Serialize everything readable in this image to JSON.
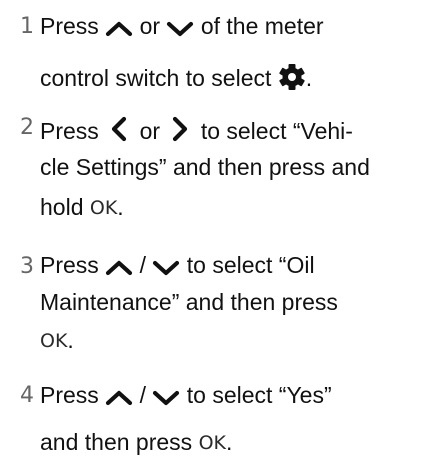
{
  "steps": [
    {
      "number": "1",
      "lines": [
        {
          "t1": "Press",
          "t2": "or",
          "t3": "of the meter"
        },
        {
          "t1": "control switch to select",
          "t2": "."
        }
      ]
    },
    {
      "number": "2",
      "lines": [
        {
          "t1": "Press",
          "t2": "or",
          "t3": "to select “Vehi-"
        },
        {
          "t1": "cle Settings” and then press and"
        },
        {
          "t1": "hold",
          "t2": "."
        }
      ]
    },
    {
      "number": "3",
      "lines": [
        {
          "t1": "Press",
          "t2": "/",
          "t3": "to select “Oil"
        },
        {
          "t1": "Maintenance” and then press"
        },
        {
          "t2": "."
        }
      ]
    },
    {
      "number": "4",
      "lines": [
        {
          "t1": "Press",
          "t2": "/",
          "t3": "to select “Yes”"
        },
        {
          "t1": "and then press",
          "t2": "."
        }
      ]
    }
  ],
  "ok_label": "OK",
  "icons": {
    "up": "chevron-up-icon",
    "down": "chevron-down-icon",
    "left": "chevron-left-icon",
    "right": "chevron-right-icon",
    "settings": "gear-icon"
  }
}
